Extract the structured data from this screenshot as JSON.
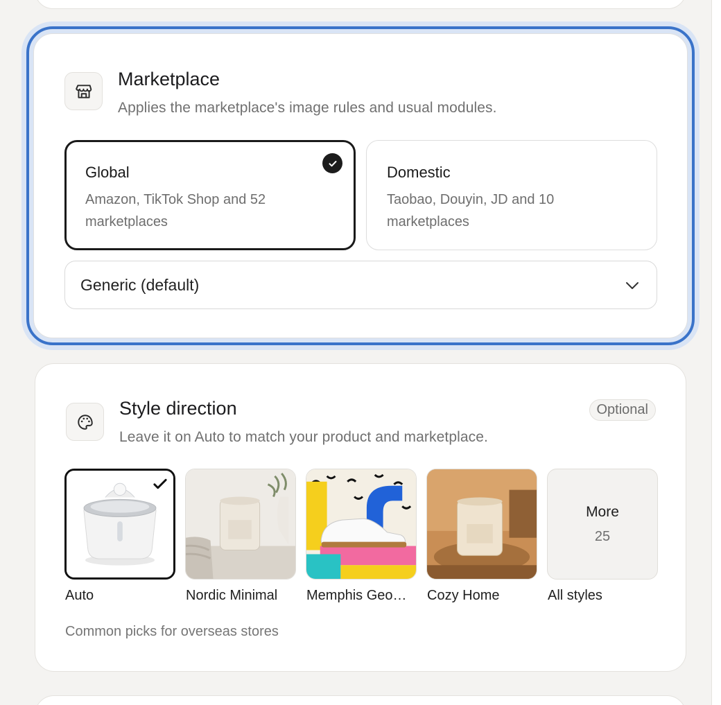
{
  "marketplace": {
    "title": "Marketplace",
    "subtitle": "Applies the marketplace's image rules and usual modules.",
    "icon": "storefront-icon",
    "options": [
      {
        "title": "Global",
        "description": "Amazon, TikTok Shop and 52 marketplaces",
        "selected": true
      },
      {
        "title": "Domestic",
        "description": "Taobao, Douyin, JD and 10 marketplaces",
        "selected": false
      }
    ],
    "select_value": "Generic (default)"
  },
  "style_direction": {
    "title": "Style direction",
    "subtitle": "Leave it on Auto to match your product and marketplace.",
    "badge": "Optional",
    "icon": "palette-icon",
    "tiles": [
      {
        "label": "Auto",
        "selected": true
      },
      {
        "label": "Nordic Minimal",
        "selected": false
      },
      {
        "label": "Memphis Geo…",
        "selected": false
      },
      {
        "label": "Cozy Home",
        "selected": false
      },
      {
        "label": "All styles",
        "selected": false
      }
    ],
    "more": {
      "title": "More",
      "count": "25"
    },
    "footnote": "Common picks for overseas stores"
  },
  "colors": {
    "focus_ring": "#3a73c9",
    "selected_border": "#1a1a1a"
  }
}
